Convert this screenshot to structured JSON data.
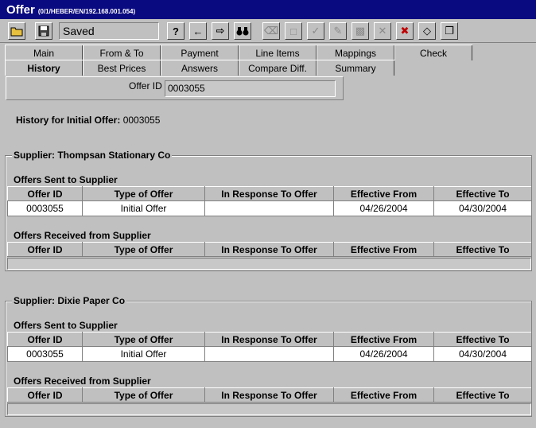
{
  "window": {
    "title": "Offer",
    "subtitle": "(0/1/HEBER/EN/192.168.001.054)"
  },
  "toolbar": {
    "status": "Saved",
    "icons": [
      "open-folder-icon",
      "save-disk-icon",
      "help-icon",
      "back-arrow-icon",
      "exit-icon",
      "binoculars-icon",
      "trash-icon",
      "comment-icon",
      "check-doc-icon",
      "edit-icon",
      "print-icon",
      "cancel-x-icon",
      "reject-icon",
      "tag-icon",
      "copy-pages-icon"
    ]
  },
  "tabs": {
    "row1": [
      "Main",
      "From & To",
      "Payment",
      "Line Items",
      "Mappings",
      "Check"
    ],
    "row2": [
      "History",
      "Best Prices",
      "Answers",
      "Compare Diff.",
      "Summary"
    ]
  },
  "offer": {
    "id_label": "Offer ID",
    "id_value": "0003055"
  },
  "history": {
    "label": "History for Initial Offer:",
    "value": "0003055"
  },
  "columns": [
    "Offer ID",
    "Type of Offer",
    "In Response To Offer",
    "Effective From",
    "Effective To"
  ],
  "suppliers": [
    {
      "legend": "Supplier: Thompsan Stationary Co",
      "sent_title": "Offers Sent to Supplier",
      "sent_rows": [
        [
          "0003055",
          "Initial Offer",
          "",
          "04/26/2004",
          "04/30/2004"
        ]
      ],
      "received_title": "Offers Received from Supplier"
    },
    {
      "legend": "Supplier: Dixie Paper Co",
      "sent_title": "Offers Sent to Supplier",
      "sent_rows": [
        [
          "0003055",
          "Initial Offer",
          "",
          "04/26/2004",
          "04/30/2004"
        ]
      ],
      "received_title": "Offers Received from Supplier"
    }
  ]
}
